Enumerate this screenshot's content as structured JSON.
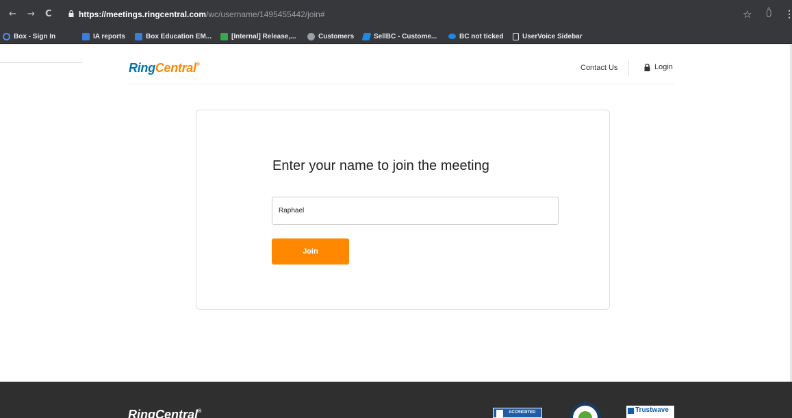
{
  "browser": {
    "url_host": "https://meetings.ringcentral.com",
    "url_path": "/wc/username/1495455442/join#",
    "bookmarks": [
      {
        "label": "Box - Sign In",
        "color": "#4f8ef7"
      },
      {
        "label": "IA reports",
        "color": "#3b7ddd"
      },
      {
        "label": "Box Education EM...",
        "color": "#3b7ddd"
      },
      {
        "label": "[Internal] Release,...",
        "color": "#34a853"
      },
      {
        "label": "Customers",
        "color": "#9aa0a6"
      },
      {
        "label": "SellBC - Custome...",
        "color": "#1e88e5"
      },
      {
        "label": "BC not ticked",
        "color": "#1e88e5"
      },
      {
        "label": "UserVoice Sidebar",
        "color": "#e8eaed"
      }
    ]
  },
  "header": {
    "logo_ring": "Ring",
    "logo_central": "Central",
    "logo_reg": "®",
    "contact_label": "Contact Us",
    "login_label": "Login"
  },
  "join": {
    "title": "Enter your name to join the meeting",
    "name_value": "Raphael",
    "join_label": "Join"
  },
  "footer": {
    "logo": "RingCentral",
    "logo_reg": "®",
    "bbb_text": "ACCREDITED",
    "trustwave_text": "Trustwave"
  },
  "colors": {
    "accent_orange": "#ff8800",
    "brand_blue": "#0073ae",
    "footer_bg": "#2f2f2f"
  }
}
